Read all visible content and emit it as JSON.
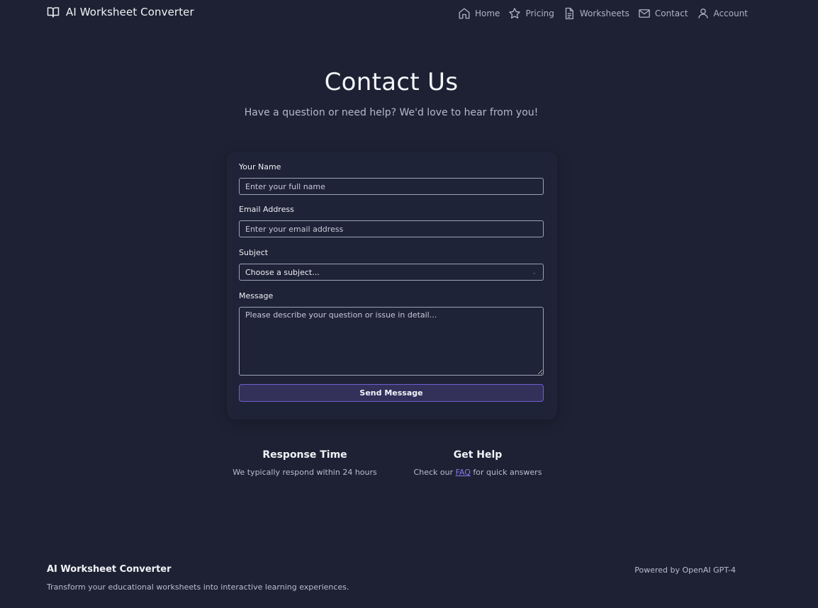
{
  "header": {
    "brand": "AI Worksheet Converter",
    "brand_icon": "book-open-icon",
    "nav": [
      {
        "label": "Home",
        "icon": "home-icon"
      },
      {
        "label": "Pricing",
        "icon": "star-icon"
      },
      {
        "label": "Worksheets",
        "icon": "document-icon"
      },
      {
        "label": "Contact",
        "icon": "mail-icon"
      },
      {
        "label": "Account",
        "icon": "user-icon"
      }
    ]
  },
  "hero": {
    "title": "Contact Us",
    "subtitle": "Have a question or need help? We'd love to hear from you!"
  },
  "form": {
    "name_label": "Your Name",
    "name_placeholder": "Enter your full name",
    "email_label": "Email Address",
    "email_placeholder": "Enter your email address",
    "subject_label": "Subject",
    "subject_value": "Choose a subject...",
    "message_label": "Message",
    "message_placeholder": "Please describe your question or issue in detail...",
    "submit_label": "Send Message"
  },
  "info": {
    "response_title": "Response Time",
    "response_text": "We typically respond within 24 hours",
    "help_title": "Get Help",
    "help_text_before": "Check our ",
    "help_link": "FAQ",
    "help_text_after": " for quick answers"
  },
  "footer": {
    "brand": "AI Worksheet Converter",
    "tagline": "Transform your educational worksheets into interactive learning experiences.",
    "powered": "Powered by OpenAI GPT-4"
  },
  "colors": {
    "background": "#1d2133",
    "accent": "#6d5fd0",
    "link": "#8a7cf0"
  }
}
